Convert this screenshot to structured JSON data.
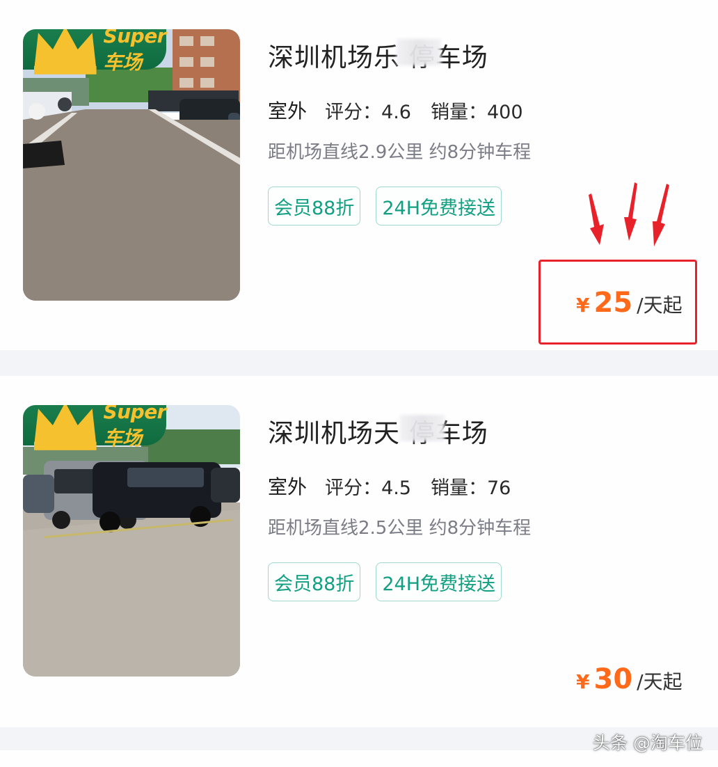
{
  "listings": [
    {
      "badge": "Super车场",
      "title": "深圳机场乐  停车场",
      "type": "室外",
      "rating_label": "评分：",
      "rating": "4.6",
      "sales_label": "销量：",
      "sales": "400",
      "distance": "距机场直线2.9公里 约8分钟车程",
      "tags": [
        "会员88折",
        "24H免费接送"
      ],
      "price_currency": "¥",
      "price_value": "25",
      "price_unit": "/天起"
    },
    {
      "badge": "Super车场",
      "title": "深圳机场天  停车场",
      "type": "室外",
      "rating_label": "评分：",
      "rating": "4.5",
      "sales_label": "销量：",
      "sales": "76",
      "distance": "距机场直线2.5公里 约8分钟车程",
      "tags": [
        "会员88折",
        "24H免费接送"
      ],
      "price_currency": "¥",
      "price_value": "30",
      "price_unit": "/天起"
    }
  ],
  "watermark": "头条 @淘车位",
  "colors": {
    "price": "#ff6a1a",
    "tag_text": "#139f82",
    "badge_bg": "#0f6b3f",
    "badge_text": "#f6c12e",
    "annotation_red": "#e8222a"
  }
}
